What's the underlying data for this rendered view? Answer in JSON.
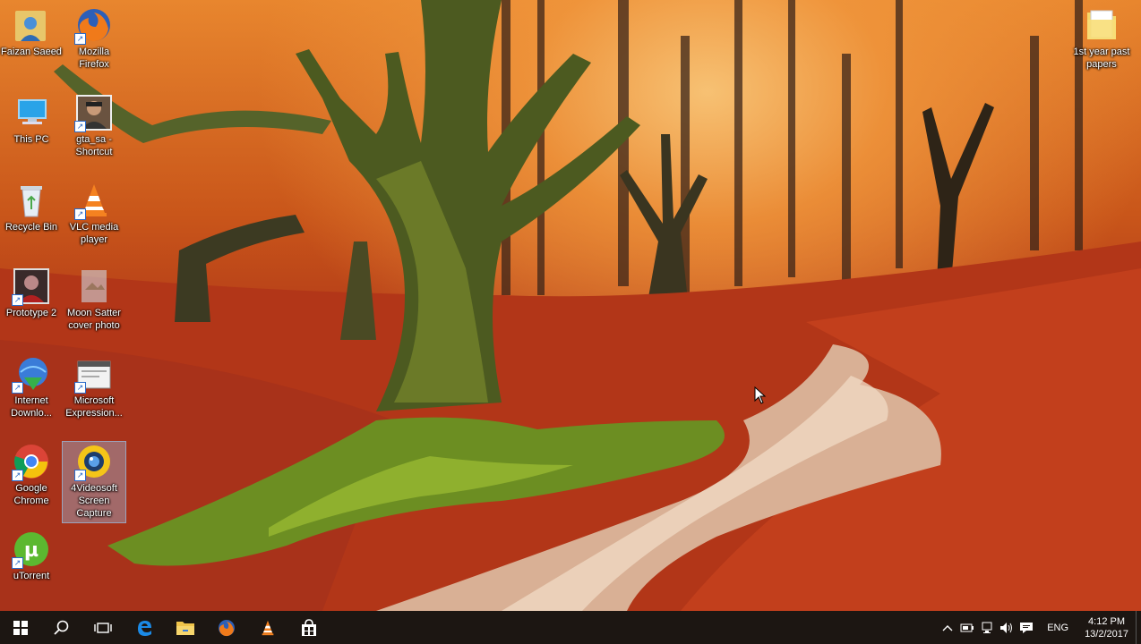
{
  "desktop_icons": [
    {
      "label": "Faizan Saeed",
      "icon": "user-folder-icon"
    },
    {
      "label": "Mozilla\nFirefox",
      "icon": "firefox-icon"
    },
    {
      "label": "This PC",
      "icon": "this-pc-icon"
    },
    {
      "label": "gta_sa -\nShortcut",
      "icon": "gta-sa-icon"
    },
    {
      "label": "Recycle Bin",
      "icon": "recycle-bin-icon"
    },
    {
      "label": "VLC media\nplayer",
      "icon": "vlc-icon"
    },
    {
      "label": "Prototype 2",
      "icon": "prototype-2-icon"
    },
    {
      "label": "Moon Satter\ncover photo",
      "icon": "photo-file-icon"
    },
    {
      "label": "Internet\nDownlo...",
      "icon": "internet-download-manager-icon"
    },
    {
      "label": "Microsoft\nExpression...",
      "icon": "microsoft-expression-icon"
    },
    {
      "label": "Google\nChrome",
      "icon": "chrome-icon"
    },
    {
      "label": "4Videosoft\nScreen\nCapture",
      "icon": "4videosoft-icon"
    },
    {
      "label": "uTorrent",
      "icon": "utorrent-icon"
    },
    {
      "label": "1st year past\npapers",
      "icon": "folder-icon"
    }
  ],
  "taskbar": {
    "pinned": [
      "start-icon",
      "search-icon",
      "task-view-icon",
      "edge-icon",
      "file-explorer-icon",
      "firefox-icon",
      "vlc-icon",
      "store-icon"
    ],
    "tray": {
      "language": "ENG",
      "time": "4:12 PM",
      "date": "13/2/2017"
    }
  },
  "colors": {
    "taskbar_bg": "#1c1612",
    "wallpaper_leaves": "#b23a18",
    "moss": "#5a7a1e"
  }
}
